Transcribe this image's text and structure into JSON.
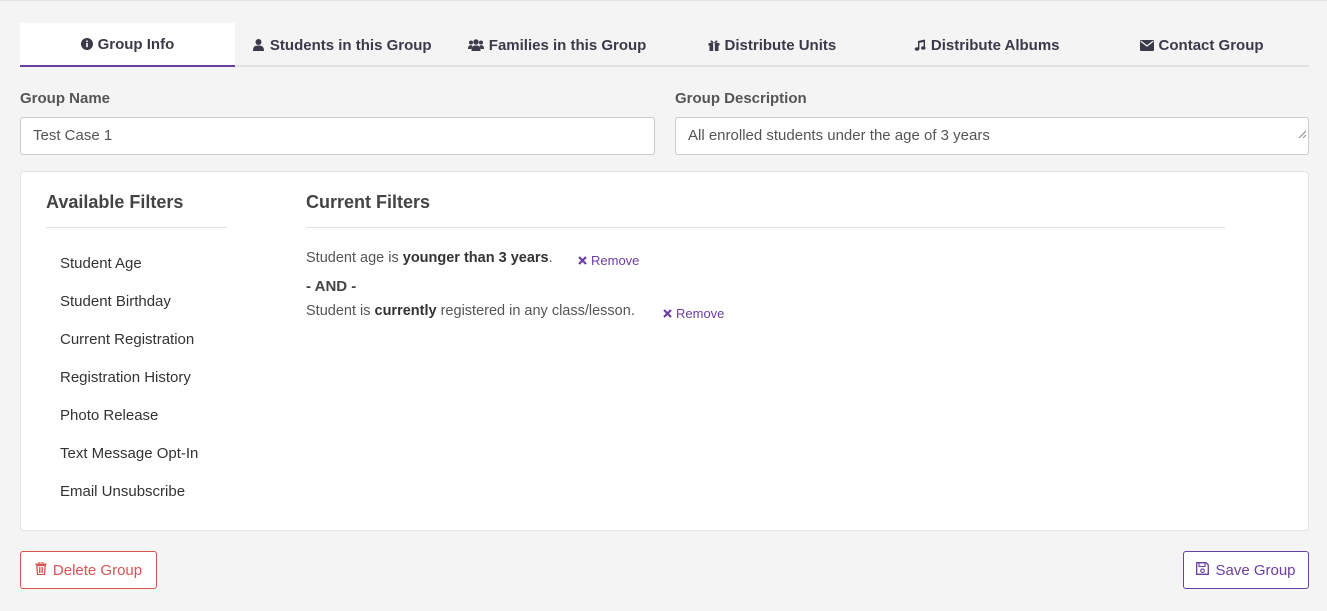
{
  "tabs": [
    {
      "label": "Group Info",
      "icon": "info-circle-icon",
      "active": true
    },
    {
      "label": "Students in this Group",
      "icon": "user-icon",
      "active": false
    },
    {
      "label": "Families in this Group",
      "icon": "users-icon",
      "active": false
    },
    {
      "label": "Distribute Units",
      "icon": "gift-icon",
      "active": false
    },
    {
      "label": "Distribute Albums",
      "icon": "music-icon",
      "active": false
    },
    {
      "label": "Contact Group",
      "icon": "envelope-icon",
      "active": false
    }
  ],
  "form": {
    "group_name_label": "Group Name",
    "group_name_value": "Test Case 1",
    "group_description_label": "Group Description",
    "group_description_value": "All enrolled students under the age of 3 years"
  },
  "available_filters": {
    "title": "Available Filters",
    "items": [
      "Student Age",
      "Student Birthday",
      "Current Registration",
      "Registration History",
      "Photo Release",
      "Text Message Opt-In",
      "Email Unsubscribe"
    ]
  },
  "current_filters": {
    "title": "Current Filters",
    "filters": [
      {
        "prefix": "Student age is ",
        "emphasis": "younger than 3 years",
        "suffix": ".",
        "remove_label": "Remove"
      },
      {
        "prefix": "Student is ",
        "emphasis": "currently",
        "suffix": " registered in any class/lesson.",
        "remove_label": "Remove"
      }
    ],
    "separator": "- AND -"
  },
  "buttons": {
    "delete_label": "Delete Group",
    "save_label": "Save Group"
  },
  "colors": {
    "accent": "#6b3fa0",
    "danger": "#d9534f",
    "background": "#f4f4f4"
  }
}
